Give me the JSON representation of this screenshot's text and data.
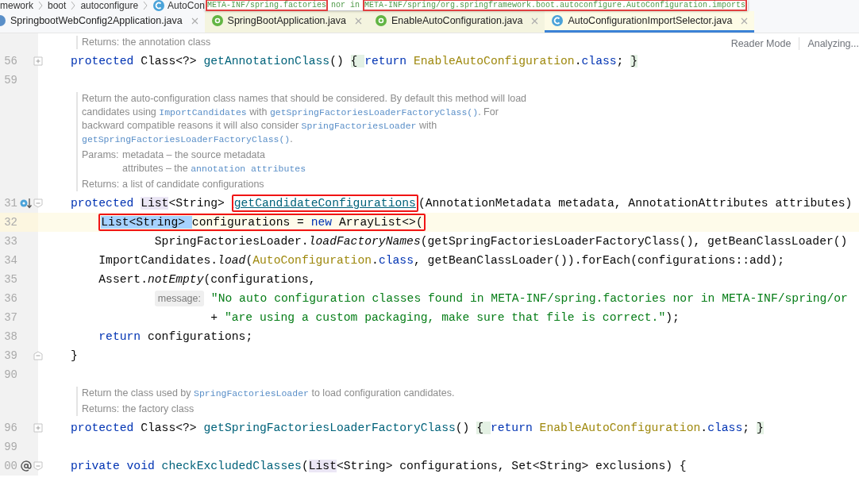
{
  "breadcrumbs": [
    "mework",
    "boot",
    "autoconfigure",
    "AutoCon"
  ],
  "popup": {
    "segments": [
      {
        "text": "META-INF/spring.factories",
        "boxed": true
      },
      {
        "text": " nor in ",
        "boxed": false
      },
      {
        "text": "META-INF/spring/org.springframework.boot.autoconfigure.AutoConfiguration.imports",
        "boxed": true
      }
    ]
  },
  "tabs": [
    {
      "label": "SpringbootWebConfig2Application.java",
      "kind": "spring",
      "library": false,
      "selected": false
    },
    {
      "label": "SpringBootApplication.java",
      "kind": "annotation",
      "library": true,
      "selected": false
    },
    {
      "label": "EnableAutoConfiguration.java",
      "kind": "annotation",
      "library": true,
      "selected": false
    },
    {
      "label": "AutoConfigurationImportSelector.java",
      "kind": "class",
      "library": true,
      "selected": true
    }
  ],
  "editor_actions": [
    "Reader Mode",
    "Analyzing..."
  ],
  "lines": [
    {
      "kind": "doc",
      "rows": [
        {
          "label": "Returns:",
          "items": [
            [
              {
                "t": "the annotation class",
                "kind": "text"
              }
            ]
          ]
        }
      ]
    },
    {
      "kind": "code",
      "number": "56",
      "fold": {
        "kind": "collapsed"
      },
      "current": false,
      "segments": [
        {
          "kind": "code",
          "tokens": [
            {
              "t": "protected",
              "kind": "kw"
            },
            {
              "t": " Class<?> ",
              "kind": "plain"
            },
            {
              "t": "getAnnotationClass",
              "kind": "method"
            },
            {
              "t": "() ",
              "kind": "plain"
            },
            {
              "t": "{ ",
              "kind": "fold"
            },
            {
              "t": "return ",
              "kind": "kw"
            },
            {
              "t": "EnableAutoConfiguration",
              "kind": "golden"
            },
            {
              "t": ".",
              "kind": "plain"
            },
            {
              "t": "class",
              "kind": "kw"
            },
            {
              "t": "; ",
              "kind": "plain"
            },
            {
              "t": "}",
              "kind": "fold"
            }
          ]
        }
      ]
    },
    {
      "kind": "code",
      "number": "59",
      "current": false
    },
    {
      "kind": "doc",
      "rows": [
        {
          "items": [
            [
              {
                "t": "Return the auto-configuration class names that should be considered. By default this method will load candidates using ",
                "kind": "text"
              },
              {
                "t": "ImportCandidates",
                "kind": "code"
              },
              {
                "t": " with ",
                "kind": "text"
              },
              {
                "t": "getSpringFactoriesLoaderFactoryClass()",
                "kind": "code"
              },
              {
                "t": ". For backward compatible reasons it will also consider ",
                "kind": "text"
              },
              {
                "t": "SpringFactoriesLoader",
                "kind": "code"
              },
              {
                "t": " with ",
                "kind": "text"
              },
              {
                "t": "getSpringFactoriesLoaderFactoryClass()",
                "kind": "code"
              },
              {
                "t": ".",
                "kind": "text"
              }
            ]
          ]
        },
        {
          "label": "Params:",
          "items": [
            [
              {
                "t": "metadata – the source metadata",
                "kind": "text"
              }
            ],
            [
              {
                "t": "attributes – the ",
                "kind": "text"
              },
              {
                "t": "annotation attributes",
                "kind": "code"
              }
            ]
          ]
        },
        {
          "label": "Returns:",
          "items": [
            [
              {
                "t": "a list of candidate configurations",
                "kind": "text"
              }
            ]
          ]
        }
      ]
    },
    {
      "kind": "code",
      "number": "31",
      "gutter_icon": {
        "kind": "override"
      },
      "fold": {
        "kind": "start"
      },
      "current": false,
      "segments": [
        {
          "kind": "code",
          "tokens": [
            {
              "t": "protected ",
              "kind": "kw"
            },
            {
              "t": "List",
              "kind": "usage"
            },
            {
              "t": "<String> ",
              "kind": "plain"
            },
            {
              "t": "getCandidateConfigurations",
              "kind": "link",
              "boxed": true
            },
            {
              "t": "(AnnotationMetadata metadata, AnnotationAttributes attributes)",
              "kind": "plain"
            }
          ]
        }
      ]
    },
    {
      "kind": "code",
      "number": "32",
      "current": true,
      "segments": [
        {
          "kind": "code",
          "tokens": [
            {
              "t": "    List<String> ",
              "kind": "selected",
              "boxed": true
            },
            {
              "t": "configurations = ",
              "kind": "plain",
              "boxed": true
            },
            {
              "t": "new",
              "kind": "kw",
              "boxed": true
            },
            {
              "t": " ArrayList<>(",
              "kind": "plain",
              "boxed": true
            }
          ]
        }
      ]
    },
    {
      "kind": "code",
      "number": "33",
      "current": false,
      "segments": [
        {
          "kind": "code",
          "tokens": [
            {
              "t": "            SpringFactoriesLoader.",
              "kind": "plain"
            },
            {
              "t": "loadFactoryNames",
              "kind": "italic"
            },
            {
              "t": "(getSpringFactoriesLoaderFactoryClass(), getBeanClassLoader()",
              "kind": "plain"
            }
          ]
        }
      ]
    },
    {
      "kind": "code",
      "number": "34",
      "current": false,
      "segments": [
        {
          "kind": "code",
          "tokens": [
            {
              "t": "    ImportCandidates.",
              "kind": "plain"
            },
            {
              "t": "load",
              "kind": "italic"
            },
            {
              "t": "(",
              "kind": "plain"
            },
            {
              "t": "AutoConfiguration",
              "kind": "golden"
            },
            {
              "t": ".",
              "kind": "plain"
            },
            {
              "t": "class",
              "kind": "kw"
            },
            {
              "t": ", getBeanClassLoader()).forEach(configurations::add);",
              "kind": "plain"
            }
          ]
        }
      ]
    },
    {
      "kind": "code",
      "number": "35",
      "current": false,
      "segments": [
        {
          "kind": "code",
          "tokens": [
            {
              "t": "    Assert.",
              "kind": "plain"
            },
            {
              "t": "notEmpty",
              "kind": "italic"
            },
            {
              "t": "(configurations,",
              "kind": "plain"
            }
          ]
        }
      ]
    },
    {
      "kind": "code",
      "number": "36",
      "current": false,
      "segments": [
        {
          "kind": "hint",
          "text": "            message:"
        },
        {
          "kind": "code",
          "tokens": [
            {
              "t": " \"No auto configuration classes found in META-INF/spring.factories nor in META-INF/spring/or",
              "kind": "string"
            }
          ]
        }
      ]
    },
    {
      "kind": "code",
      "number": "37",
      "current": false,
      "segments": [
        {
          "kind": "code",
          "tokens": [
            {
              "t": "                    + ",
              "kind": "plain"
            },
            {
              "t": "\"are using a custom packaging, make sure that file is correct.\"",
              "kind": "string"
            },
            {
              "t": ");",
              "kind": "plain"
            }
          ]
        }
      ]
    },
    {
      "kind": "code",
      "number": "38",
      "current": false,
      "segments": [
        {
          "kind": "code",
          "tokens": [
            {
              "t": "    return",
              "kind": "kw"
            },
            {
              "t": " configurations;",
              "kind": "plain"
            }
          ]
        }
      ]
    },
    {
      "kind": "code",
      "number": "39",
      "fold": {
        "kind": "end"
      },
      "current": false,
      "segments": [
        {
          "kind": "code",
          "tokens": [
            {
              "t": "}",
              "kind": "plain"
            }
          ]
        }
      ]
    },
    {
      "kind": "code",
      "number": "90",
      "current": false
    },
    {
      "kind": "doc",
      "rows": [
        {
          "items": [
            [
              {
                "t": "Return the class used by ",
                "kind": "text"
              },
              {
                "t": "SpringFactoriesLoader",
                "kind": "code"
              },
              {
                "t": " to load configuration candidates.",
                "kind": "text"
              }
            ]
          ]
        },
        {
          "label": "Returns:",
          "items": [
            [
              {
                "t": "the factory class",
                "kind": "text"
              }
            ]
          ]
        }
      ]
    },
    {
      "kind": "code",
      "number": "96",
      "fold": {
        "kind": "collapsed"
      },
      "current": false,
      "segments": [
        {
          "kind": "code",
          "tokens": [
            {
              "t": "protected",
              "kind": "kw"
            },
            {
              "t": " Class<?> ",
              "kind": "plain"
            },
            {
              "t": "getSpringFactoriesLoaderFactoryClass",
              "kind": "method"
            },
            {
              "t": "() ",
              "kind": "plain"
            },
            {
              "t": "{ ",
              "kind": "fold"
            },
            {
              "t": "return ",
              "kind": "kw"
            },
            {
              "t": "EnableAutoConfiguration",
              "kind": "golden"
            },
            {
              "t": ".",
              "kind": "plain"
            },
            {
              "t": "class",
              "kind": "kw"
            },
            {
              "t": "; ",
              "kind": "plain"
            },
            {
              "t": "}",
              "kind": "fold"
            }
          ]
        }
      ]
    },
    {
      "kind": "code",
      "number": "99",
      "current": false
    },
    {
      "kind": "code",
      "number": "00",
      "gutter_icon": {
        "kind": "annotation"
      },
      "fold": {
        "kind": "start"
      },
      "current": false,
      "segments": [
        {
          "kind": "code",
          "tokens": [
            {
              "t": "private void ",
              "kind": "kw"
            },
            {
              "t": "checkExcludedClasses",
              "kind": "method"
            },
            {
              "t": "(",
              "kind": "plain"
            },
            {
              "t": "List",
              "kind": "usage"
            },
            {
              "t": "<String> configurations, Set<String> exclusions) {",
              "kind": "plain"
            }
          ]
        }
      ]
    }
  ]
}
